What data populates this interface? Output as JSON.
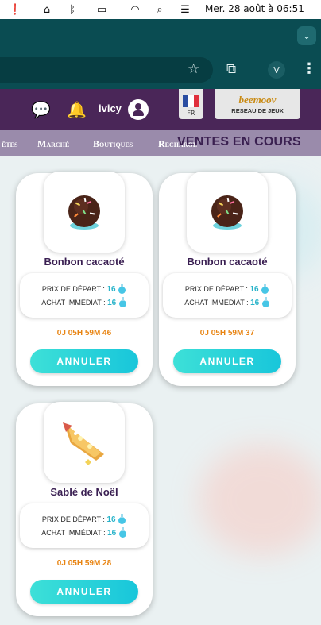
{
  "menubar": {
    "datetime": "Mer. 28 août à  06:51"
  },
  "browser": {
    "profile_initial": "V"
  },
  "site_header": {
    "username": "ivicy",
    "language": "FR",
    "brand_name": "beemoov",
    "brand_tagline": "RESEAU DE JEUX"
  },
  "nav": {
    "items": [
      "êtes",
      "Marché",
      "Boutiques",
      "Recharge"
    ],
    "section_title": "VENTES EN COURS"
  },
  "listings": [
    {
      "name": "Bonbon cacaoté",
      "start_label": "PRIX DE DÉPART :",
      "start_price": "16",
      "buy_label": "ACHAT IMMÉDIAT :",
      "buy_price": "16",
      "timer": "0J 05H 59M 46",
      "button": "ANNULER"
    },
    {
      "name": "Bonbon cacaoté",
      "start_label": "PRIX DE DÉPART :",
      "start_price": "16",
      "buy_label": "ACHAT IMMÉDIAT :",
      "buy_price": "16",
      "timer": "0J 05H 59M 37",
      "button": "ANNULER"
    },
    {
      "name": "Sablé de Noël",
      "start_label": "PRIX DE DÉPART :",
      "start_price": "16",
      "buy_label": "ACHAT IMMÉDIAT :",
      "buy_price": "16",
      "timer": "0J 05H 59M 28",
      "button": "ANNULER"
    }
  ],
  "colors": {
    "header_purple": "#4a2658",
    "nav_lavender": "#9a8bab",
    "price_cyan": "#27b3c9",
    "timer_orange": "#e88412",
    "button_cyan": "#18c6da"
  }
}
